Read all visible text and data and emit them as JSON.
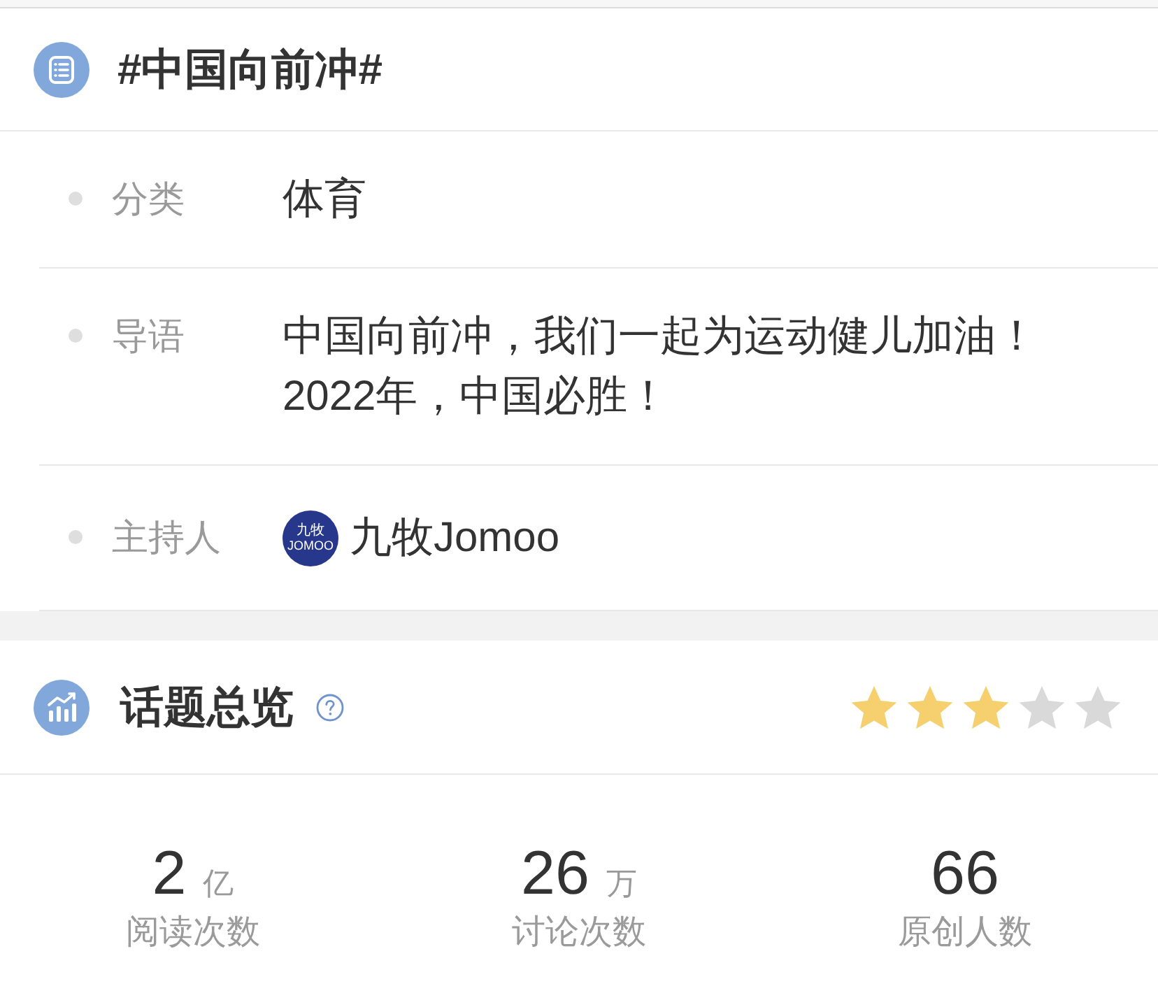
{
  "topic": {
    "title": "#中国向前冲#"
  },
  "details": [
    {
      "kind": "text",
      "label": "分类",
      "value": "体育"
    },
    {
      "kind": "text",
      "label": "导语",
      "value": "中国向前冲，我们一起为运动健儿加油！\n2022年，中国必胜！"
    },
    {
      "kind": "host",
      "label": "主持人",
      "value": "九牧Jomoo",
      "logo_lines": [
        "九牧",
        "JOMOO"
      ]
    }
  ],
  "overview": {
    "title": "话题总览",
    "stars": 3
  },
  "stats": [
    {
      "value": "2",
      "unit": "亿",
      "label": "阅读次数"
    },
    {
      "value": "26",
      "unit": "万",
      "label": "讨论次数"
    },
    {
      "value": "66",
      "label": "原创人数"
    }
  ]
}
